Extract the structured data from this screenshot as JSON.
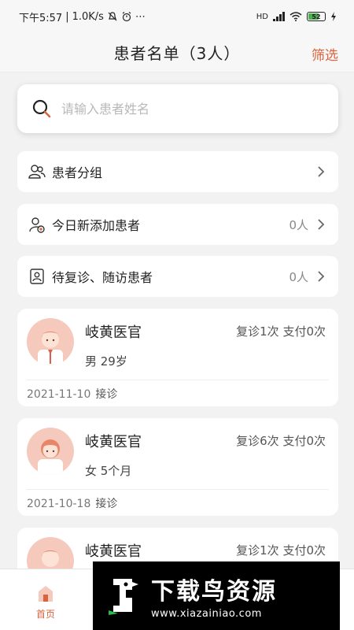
{
  "status_bar": {
    "time": "下午5:57",
    "speed": "1.0K/s",
    "extra": "⋯",
    "network_label": "HD",
    "battery": "52"
  },
  "header": {
    "title": "患者名单（3人）",
    "filter_label": "筛选"
  },
  "search": {
    "placeholder": "请输入患者姓名",
    "value": ""
  },
  "menu": [
    {
      "label": "患者分组",
      "count": ""
    },
    {
      "label": "今日新添加患者",
      "count": "0人"
    },
    {
      "label": "待复诊、随访患者",
      "count": "0人"
    }
  ],
  "patients": [
    {
      "name": "岐黄医官",
      "stats": "复诊1次  支付0次",
      "info": "男  29岁",
      "date": "2021-11-10",
      "action": "接诊",
      "gender": "male"
    },
    {
      "name": "岐黄医官",
      "stats": "复诊6次  支付0次",
      "info": "女  5个月",
      "date": "2021-10-18",
      "action": "接诊",
      "gender": "female"
    },
    {
      "name": "岐黄医官",
      "stats": "复诊1次  支付0次",
      "info": "",
      "date": "",
      "action": "",
      "gender": "male"
    }
  ],
  "bottom_nav": {
    "home_label": "首页"
  },
  "watermark": {
    "title": "下载鸟资源",
    "url": "www.xiazainiao.com"
  },
  "colors": {
    "accent": "#d9633c",
    "avatar_bg": "#f6c9bd"
  }
}
